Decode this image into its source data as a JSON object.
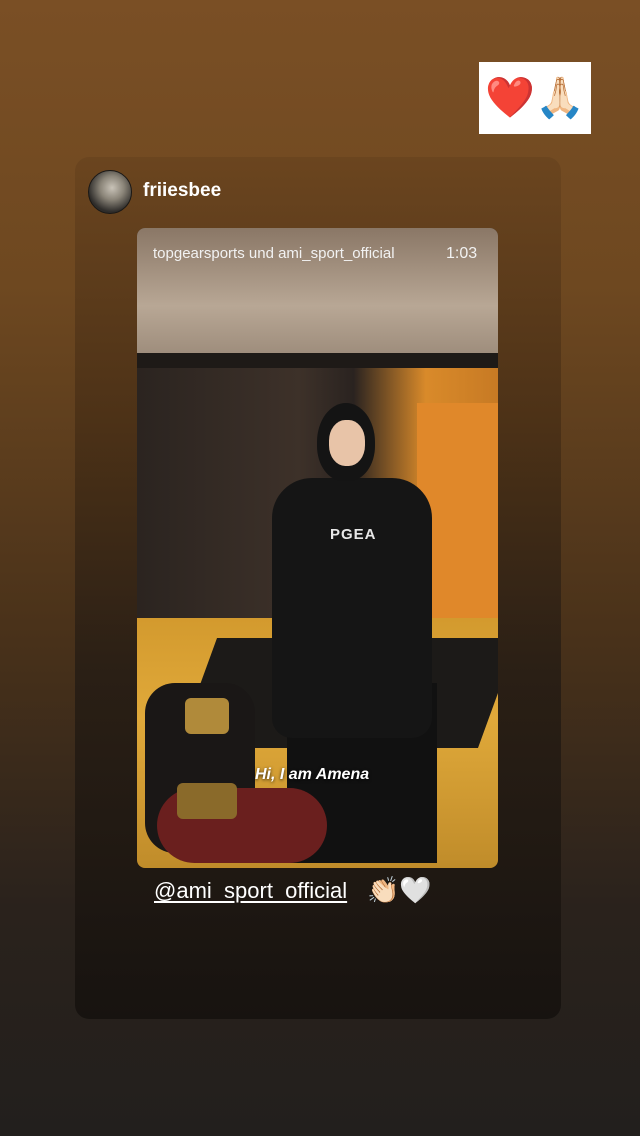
{
  "sticker": {
    "emojis": "❤️🙏🏻"
  },
  "post": {
    "username": "friiesbee",
    "video": {
      "header": "topgearsports und ami_sport_official",
      "duration": "1:03",
      "subtitle": "Hi, I am Amena",
      "shirt_logo": "PGEA"
    },
    "mention": "@ami_sport_official",
    "mention_emojis": "👏🏻🤍"
  }
}
